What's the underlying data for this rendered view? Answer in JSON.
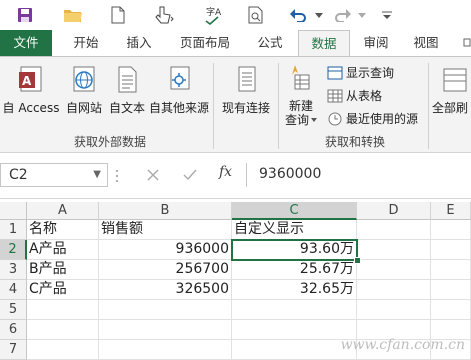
{
  "tabs": [
    "文件",
    "开始",
    "插入",
    "页面布局",
    "公式",
    "数据",
    "审阅",
    "视图"
  ],
  "ribbon": {
    "get_external": {
      "buttons": [
        "自 Access",
        "自网站",
        "自文本",
        "自其他来源"
      ],
      "group_label": "获取外部数据"
    },
    "connections": {
      "button": "现有连接"
    },
    "transform": {
      "new_query_line1": "新建",
      "new_query_line2": "查询",
      "show_queries": "显示查询",
      "from_table": "从表格",
      "recent_sources": "最近使用的源",
      "group_label": "获取和转换"
    },
    "refresh_all": "全部刷"
  },
  "formula_bar": {
    "name_box": "C2",
    "fx_label": "fx",
    "formula": "9360000"
  },
  "sheet": {
    "columns": [
      "A",
      "B",
      "C",
      "D",
      "E"
    ],
    "rows": [
      "1",
      "2",
      "3",
      "4",
      "5",
      "6",
      "7"
    ],
    "cells": {
      "A1": "名称",
      "B1": "销售额",
      "C1": "自定义显示",
      "A2": "A产品",
      "B2": "936000",
      "C2": "93.60万",
      "A3": "B产品",
      "B3": "256700",
      "C3": "25.67万",
      "A4": "C产品",
      "B4": "326500",
      "C4": "32.65万"
    }
  },
  "watermark": "www.cfan.com.cn",
  "accent": "#217346"
}
